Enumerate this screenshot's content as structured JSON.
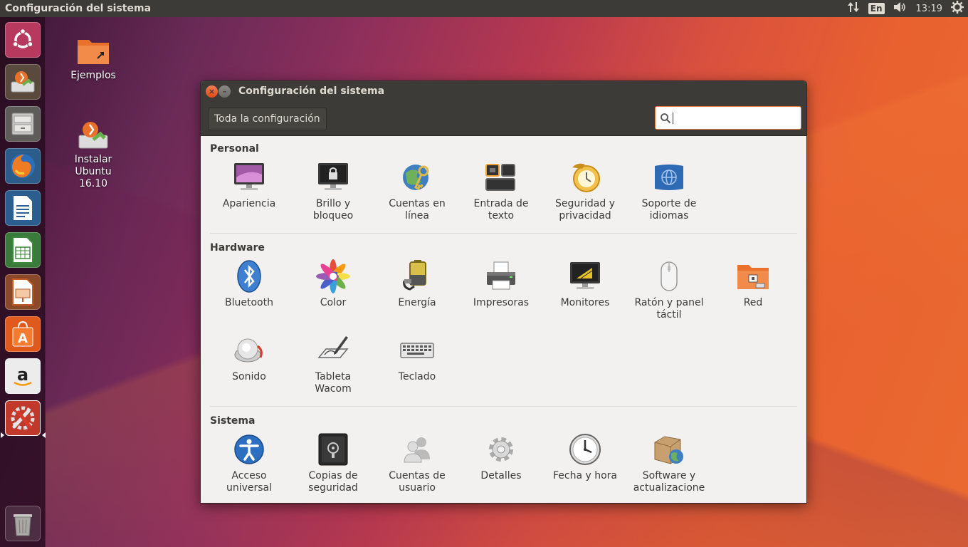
{
  "top_panel": {
    "title": "Configuración del sistema",
    "language": "En",
    "time": "13:19",
    "icons": [
      "network-transfer-icon",
      "volume-icon",
      "system-gear-icon"
    ]
  },
  "launcher": {
    "items": [
      {
        "name": "ubuntu-dash",
        "icon": "ubuntu-logo-icon"
      },
      {
        "name": "install-ubuntu",
        "icon": "installer-icon"
      },
      {
        "name": "files",
        "icon": "file-cabinet-icon"
      },
      {
        "name": "firefox",
        "icon": "firefox-icon"
      },
      {
        "name": "writer",
        "icon": "writer-icon"
      },
      {
        "name": "calc",
        "icon": "calc-icon"
      },
      {
        "name": "impress",
        "icon": "impress-icon"
      },
      {
        "name": "software-center",
        "icon": "shopping-bag-icon"
      },
      {
        "name": "amazon",
        "icon": "amazon-icon"
      },
      {
        "name": "system-settings",
        "icon": "wrench-screwdriver-icon"
      },
      {
        "name": "trash",
        "icon": "trash-icon"
      }
    ]
  },
  "desktop": {
    "icons": [
      {
        "label": "Ejemplos"
      },
      {
        "label": "Instalar\nUbuntu\n16.10"
      }
    ]
  },
  "window": {
    "title": "Configuración del sistema",
    "toolbar": {
      "all_settings_label": "Toda la configuración",
      "search_value": "",
      "search_placeholder": ""
    },
    "sections": [
      {
        "title": "Personal",
        "items": [
          {
            "label": "Apariencia",
            "icon": "appearance-monitor-icon"
          },
          {
            "label": "Brillo y\nbloqueo",
            "icon": "brightness-lock-icon"
          },
          {
            "label": "Cuentas en\nlínea",
            "icon": "online-accounts-icon"
          },
          {
            "label": "Entrada de\ntexto",
            "icon": "text-entry-icon"
          },
          {
            "label": "Seguridad y\nprivacidad",
            "icon": "security-privacy-icon"
          },
          {
            "label": "Soporte de\nidiomas",
            "icon": "language-support-icon"
          }
        ]
      },
      {
        "title": "Hardware",
        "items": [
          {
            "label": "Bluetooth",
            "icon": "bluetooth-icon"
          },
          {
            "label": "Color",
            "icon": "color-icon"
          },
          {
            "label": "Energía",
            "icon": "power-battery-icon"
          },
          {
            "label": "Impresoras",
            "icon": "printer-icon"
          },
          {
            "label": "Monitores",
            "icon": "displays-icon"
          },
          {
            "label": "Ratón y panel\ntáctil",
            "icon": "mouse-icon"
          },
          {
            "label": "Red",
            "icon": "network-folder-icon"
          },
          {
            "label": "Sonido",
            "icon": "sound-speaker-icon"
          },
          {
            "label": "Tableta\nWacom",
            "icon": "wacom-tablet-icon"
          },
          {
            "label": "Teclado",
            "icon": "keyboard-icon"
          }
        ]
      },
      {
        "title": "Sistema",
        "items": [
          {
            "label": "Acceso\nuniversal",
            "icon": "universal-access-icon"
          },
          {
            "label": "Copias de\nseguridad",
            "icon": "backup-safe-icon"
          },
          {
            "label": "Cuentas de\nusuario",
            "icon": "user-accounts-icon"
          },
          {
            "label": "Detalles",
            "icon": "details-gear-icon"
          },
          {
            "label": "Fecha y hora",
            "icon": "clock-icon"
          },
          {
            "label": "Software y\nactualizacione",
            "icon": "software-updates-icon"
          }
        ]
      }
    ]
  }
}
